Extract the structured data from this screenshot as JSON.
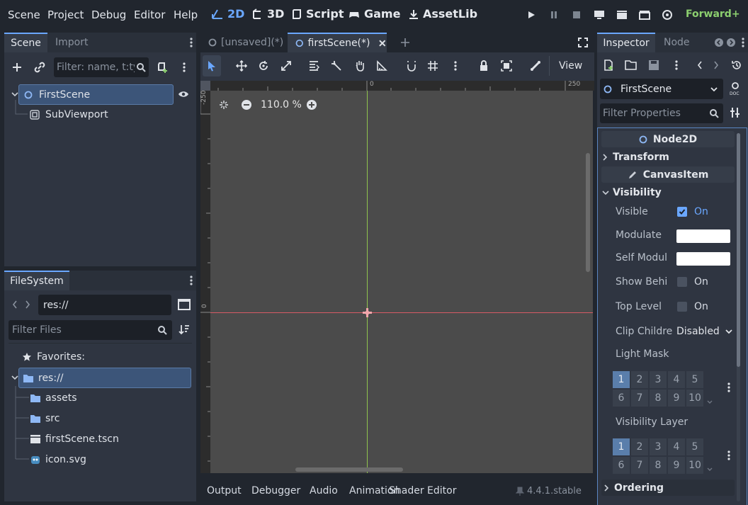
{
  "menu": [
    "Scene",
    "Project",
    "Debug",
    "Editor",
    "Help"
  ],
  "workspaces": [
    "2D",
    "3D",
    "Script",
    "Game",
    "AssetLib"
  ],
  "renderer": "Forward+",
  "scene_dock": {
    "tabs": [
      "Scene",
      "Import"
    ],
    "filter_placeholder": "Filter: name, t:ty",
    "nodes": [
      "FirstScene",
      "SubViewport"
    ]
  },
  "filesystem_dock": {
    "tab": "FileSystem",
    "path": "res://",
    "filter_placeholder": "Filter Files",
    "items": [
      "Favorites:",
      "res://",
      "assets",
      "src",
      "firstScene.tscn",
      "icon.svg"
    ]
  },
  "editor_tabs": [
    "[unsaved](*)",
    "firstScene(*)"
  ],
  "toolbar": {
    "view_label": "View"
  },
  "canvas": {
    "zoom": "110.0 %",
    "ruler_top": [
      "0",
      "250"
    ],
    "ruler_left": [
      "-250",
      "0"
    ]
  },
  "bottom_panel": {
    "tabs": [
      "Output",
      "Debugger",
      "Audio",
      "Animation",
      "Shader Editor"
    ],
    "version": "4.4.1.stable"
  },
  "inspector": {
    "tabs": [
      "Inspector",
      "Node"
    ],
    "object": "FirstScene",
    "filter_placeholder": "Filter Properties",
    "class_node2d": "Node2D",
    "transform": "Transform",
    "class_canvasitem": "CanvasItem",
    "visibility": "Visibility",
    "props": {
      "visible": {
        "label": "Visible",
        "value": "On"
      },
      "modulate": {
        "label": "Modulate"
      },
      "self_modulate": {
        "label": "Self Modul"
      },
      "show_behind": {
        "label": "Show Behi",
        "value": "On"
      },
      "top_level": {
        "label": "Top Level",
        "value": "On"
      },
      "clip_children": {
        "label": "Clip Childre",
        "value": "Disabled"
      },
      "light_mask": {
        "label": "Light Mask"
      },
      "visibility_layer": {
        "label": "Visibility Layer"
      }
    },
    "layer_numbers": [
      "1",
      "2",
      "3",
      "4",
      "5",
      "6",
      "7",
      "8",
      "9",
      "10"
    ],
    "ordering": "Ordering",
    "colors": {
      "accent": "#6aa7ff",
      "modulate": "#ffffff"
    }
  }
}
